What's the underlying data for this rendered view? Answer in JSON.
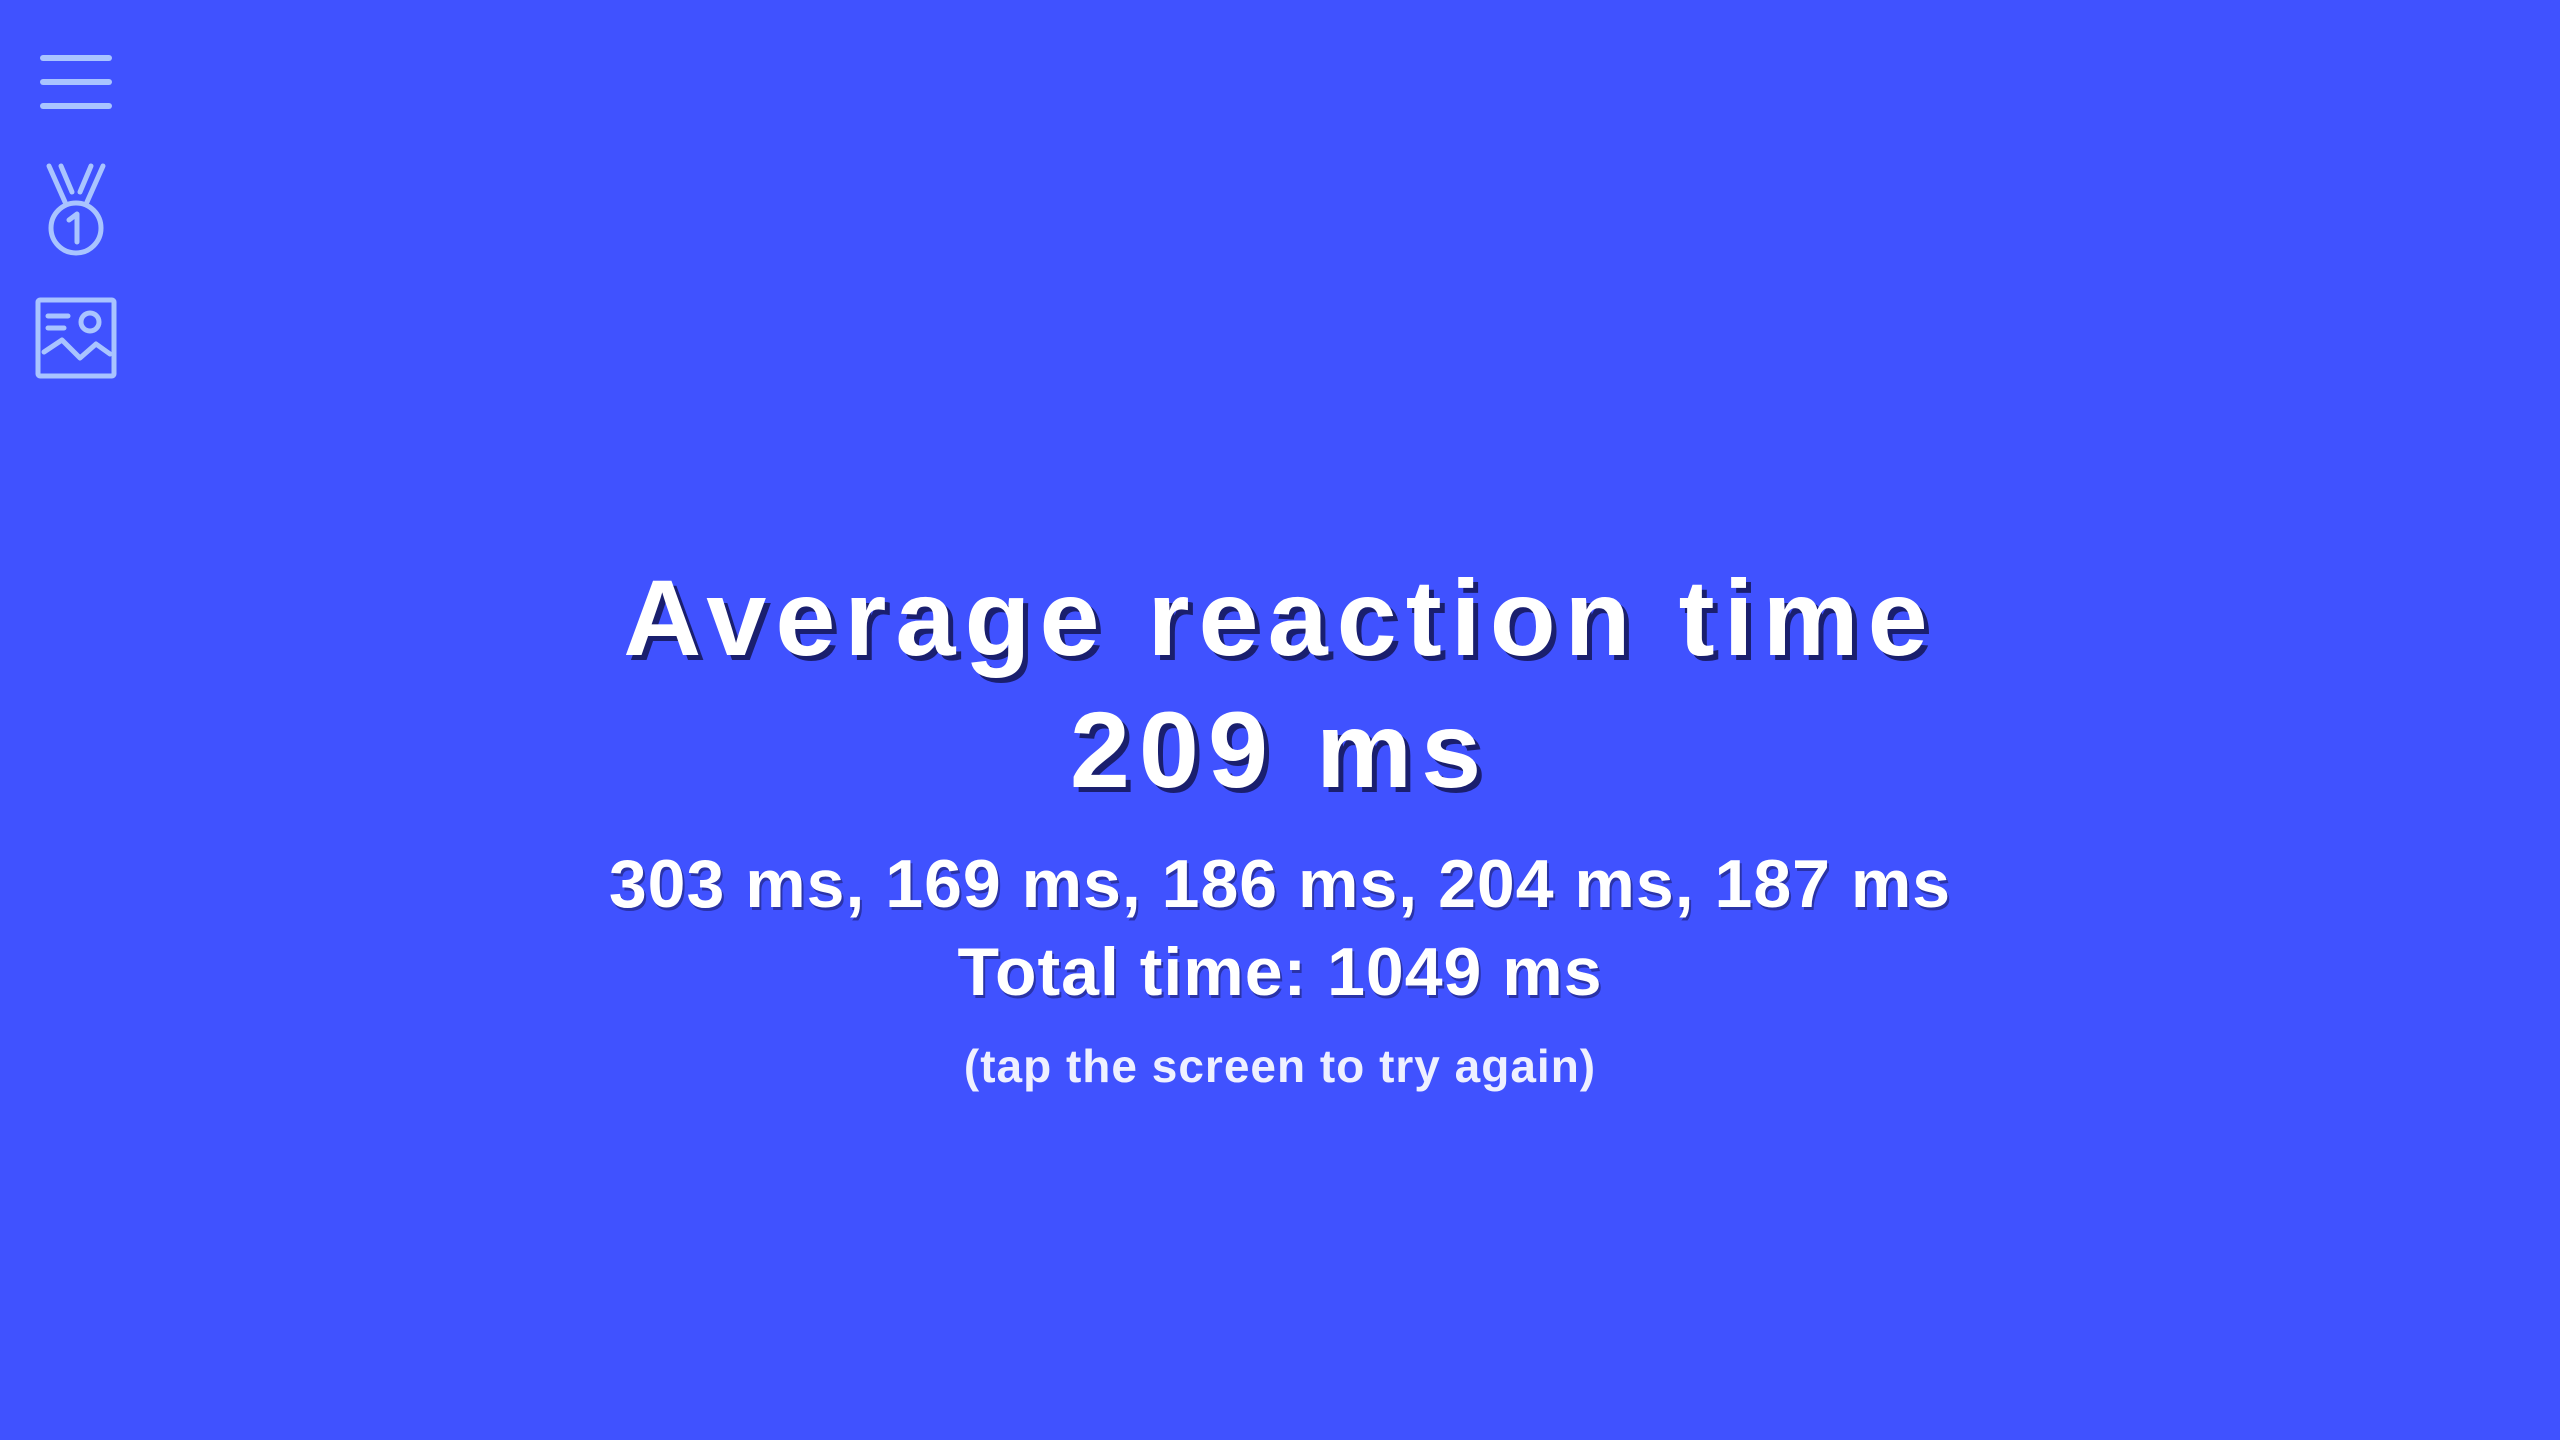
{
  "sidebar": {
    "menu_icon": "hamburger-menu-icon",
    "ranking_icon": "medal-first-place-icon",
    "gallery_icon": "image-card-icon"
  },
  "result": {
    "title": "Average reaction time",
    "average": "209 ms",
    "trials": "303 ms, 169 ms, 186 ms, 204 ms, 187 ms",
    "total": "Total time: 1049 ms",
    "hint": "(tap the screen to try again)"
  },
  "colors": {
    "background": "#4052ff",
    "text": "#ffffff",
    "icon": "#a9c4ff"
  }
}
